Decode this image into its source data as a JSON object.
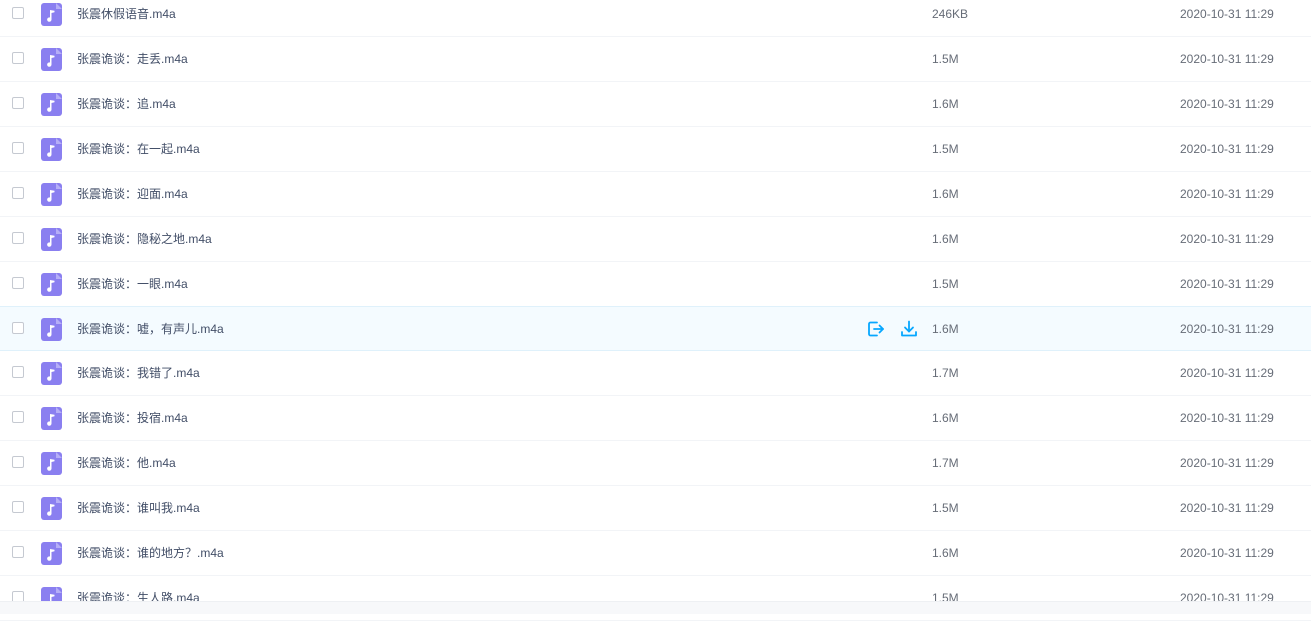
{
  "icons": {
    "file_icon": "audio-file-icon",
    "share_icon": "share-icon",
    "download_icon": "download-icon"
  },
  "colors": {
    "audio_icon": "#8a7ff0",
    "action_blue": "#06a7ff",
    "hover_row": "#f4fbff"
  },
  "files": [
    {
      "name": "张震休假语音.m4a",
      "size": "246KB",
      "time": "2020-10-31 11:29"
    },
    {
      "name": "张震诡谈：走丢.m4a",
      "size": "1.5M",
      "time": "2020-10-31 11:29"
    },
    {
      "name": "张震诡谈：追.m4a",
      "size": "1.6M",
      "time": "2020-10-31 11:29"
    },
    {
      "name": "张震诡谈：在一起.m4a",
      "size": "1.5M",
      "time": "2020-10-31 11:29"
    },
    {
      "name": "张震诡谈：迎面.m4a",
      "size": "1.6M",
      "time": "2020-10-31 11:29"
    },
    {
      "name": "张震诡谈：隐秘之地.m4a",
      "size": "1.6M",
      "time": "2020-10-31 11:29"
    },
    {
      "name": "张震诡谈：一眼.m4a",
      "size": "1.5M",
      "time": "2020-10-31 11:29"
    },
    {
      "name": "张震诡谈：嘘，有声儿.m4a",
      "size": "1.6M",
      "time": "2020-10-31 11:29"
    },
    {
      "name": "张震诡谈：我错了.m4a",
      "size": "1.7M",
      "time": "2020-10-31 11:29"
    },
    {
      "name": "张震诡谈：投宿.m4a",
      "size": "1.6M",
      "time": "2020-10-31 11:29"
    },
    {
      "name": "张震诡谈：他.m4a",
      "size": "1.7M",
      "time": "2020-10-31 11:29"
    },
    {
      "name": "张震诡谈：谁叫我.m4a",
      "size": "1.5M",
      "time": "2020-10-31 11:29"
    },
    {
      "name": "张震诡谈：谁的地方？.m4a",
      "size": "1.6M",
      "time": "2020-10-31 11:29"
    },
    {
      "name": "张震诡谈：生人路.m4a",
      "size": "1.5M",
      "time": "2020-10-31 11:29"
    }
  ]
}
